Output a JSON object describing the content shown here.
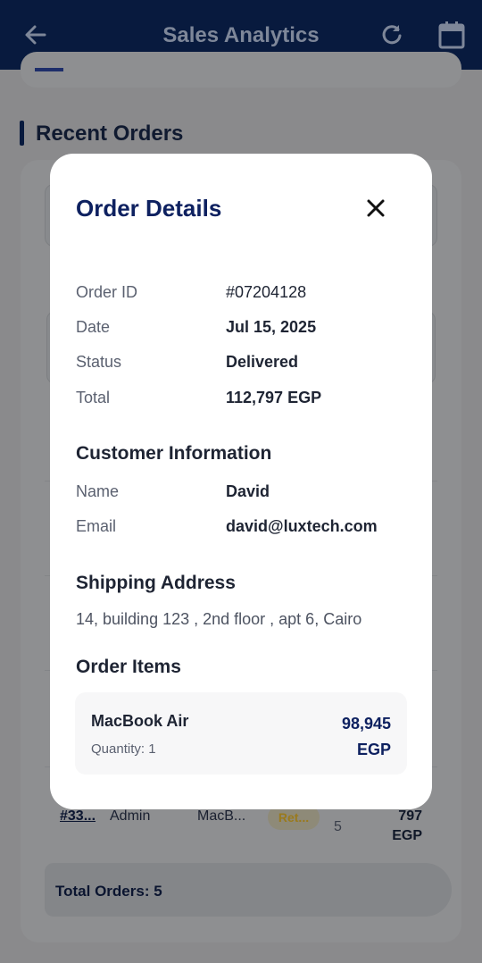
{
  "app_bar": {
    "title": "Sales Analytics",
    "icons": [
      "back-arrow-icon",
      "refresh-icon",
      "calendar-icon"
    ],
    "background": "#081a3e"
  },
  "page": {
    "section_title": "Recent Orders",
    "visible_row": {
      "order_id": "#33...",
      "user": "Admin",
      "product": "MacB...",
      "status": "Ret...",
      "qty": "5",
      "total_line1": "797",
      "total_line2": "EGP"
    },
    "summary": "Total Orders: 5"
  },
  "modal": {
    "title": "Order Details",
    "close_icon": "close-icon",
    "order": {
      "id_label": "Order ID",
      "id_value": "#07204128",
      "date_label": "Date",
      "date_value": "Jul 15, 2025",
      "status_label": "Status",
      "status_value": "Delivered",
      "total_label": "Total",
      "total_value": "112,797 EGP"
    },
    "customer": {
      "heading": "Customer Information",
      "name_label": "Name",
      "name_value": "David",
      "email_label": "Email",
      "email_value": "david@luxtech.com"
    },
    "shipping": {
      "heading": "Shipping Address",
      "address": "14, building 123 , 2nd floor , apt 6, Cairo"
    },
    "items": {
      "heading": "Order Items",
      "list": [
        {
          "name": "MacBook Air",
          "quantity": "Quantity: 1",
          "price_amount": "98,945",
          "price_currency": "EGP"
        }
      ]
    }
  },
  "colors": {
    "primary": "#0e2160",
    "overlay_dim": "#8a8a8c",
    "status_returned": "#9a7a1c"
  }
}
